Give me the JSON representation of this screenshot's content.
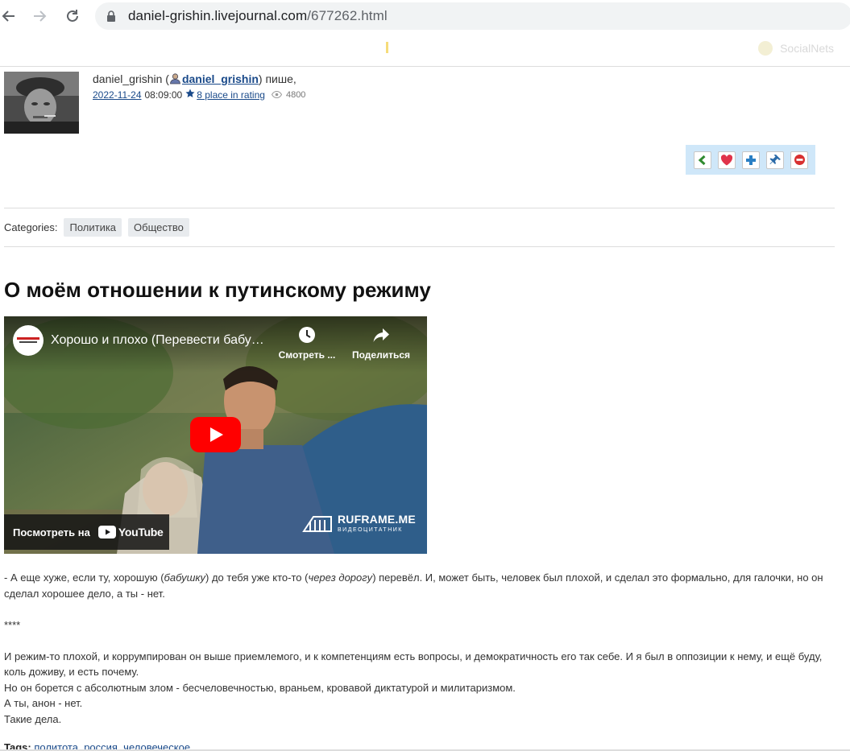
{
  "browser": {
    "url_domain": "daniel-grishin.livejournal.com",
    "url_path": "/677262.html"
  },
  "lj_nav": {
    "socialnets": "SocialNets"
  },
  "header": {
    "author_name": "daniel_grishin",
    "author_username": "daniel_grishin",
    "verb": "пише,",
    "date_link": "2022-11-24",
    "time": "08:09:00",
    "rating_link": " 8 place in rating ",
    "views": "4800"
  },
  "categories": {
    "label": "Categories:",
    "tags": [
      "Политика",
      "Общество"
    ]
  },
  "post": {
    "title": "О моём отношении к путинскому режиму"
  },
  "video": {
    "title": "Хорошо и плохо (Перевести бабушку через дорогу)",
    "watch_later": "Смотреть ...",
    "share": "Поделиться",
    "watch_on": "Посмотреть на",
    "yt_word": "YouTube",
    "watermark_name": "RUFRAME.ME",
    "watermark_sub": "ВИДЕОЦИТАТНИК"
  },
  "body": {
    "p1_a": "- А еще хуже, если ту, хорошую (",
    "p1_em1": "бабушку",
    "p1_b": ") до тебя уже кто-то (",
    "p1_em2": "через дорогу",
    "p1_c": ") перевёл. И, может быть, человек был плохой, и сделал это формально, для галочки, но он сделал хорошее дело, а ты - нет.",
    "sep": "****",
    "p2": "И режим-то плохой, и коррумпирован он выше приемлемого, и к компетенциям есть вопросы, и демократичность его так себе. И я был в оппозиции к нему, и ещё буду, коль доживу, и есть почему.",
    "p3": "Но он борется с абсолютным злом - бесчеловечностью, враньем, кровавой диктатурой и милитаризмом.",
    "p4": "А ты, анон - нет.",
    "p5": "Такие дела."
  },
  "tags": {
    "label": "Tags:",
    "items": "политота, россия, человеческое"
  }
}
